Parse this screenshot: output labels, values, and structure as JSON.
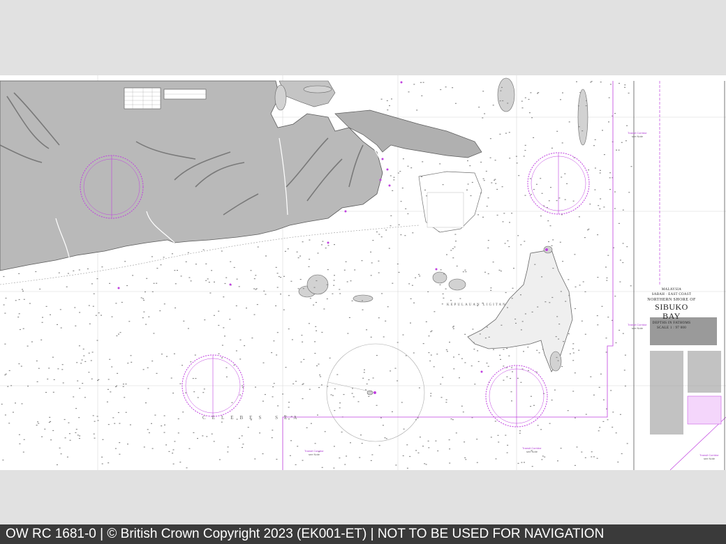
{
  "footer": {
    "text": "OW RC 1681-0 | © British Crown Copyright 2023 (EK001-ET) | NOT TO BE USED FOR NAVIGATION"
  },
  "chart_title": {
    "country": "MALAYSIA",
    "region": "SABAH · EAST COAST",
    "subtitle": "NORTHERN SHORE OF",
    "name": "SIBUKO BAY",
    "depths": "DEPTHS IN FATHOMS",
    "scale": "SCALE 1 : 97 000"
  },
  "place_names": {
    "sea": "CELEBES SEA",
    "islands": "KEPULAUAN LIGITAN"
  },
  "transit_labels": {
    "t1": "Transit Corridor",
    "t1_sub": "see Note",
    "t2": "Transit Corridor",
    "t2_sub": "see Note",
    "t3": "Transit Corridor",
    "t3_sub": "see Note",
    "t4": "Transit Corridor",
    "t4_sub": "see Note",
    "t5": "Transit Corridor",
    "t5_sub": "see Note"
  },
  "colors": {
    "land": "#b9b9b9",
    "magenta": "#c040e0",
    "footer_bg": "#3a3a3a",
    "band": "#e1e1e1"
  }
}
